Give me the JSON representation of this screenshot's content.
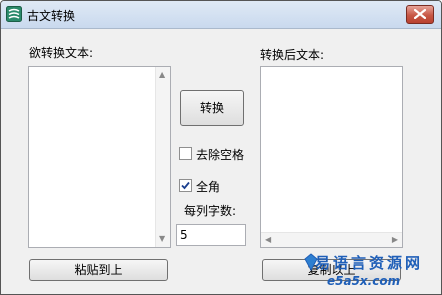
{
  "window": {
    "title": "古文转换",
    "close_icon": "close-icon"
  },
  "left": {
    "label": "欲转换文本:",
    "text": "",
    "paste_button": "粘贴到上"
  },
  "right": {
    "label": "转换后文本:",
    "text": "",
    "copy_button": "复制以上"
  },
  "middle": {
    "convert_button": "转换",
    "remove_spaces": {
      "label": "去除空格",
      "checked": false
    },
    "full_width": {
      "label": "全角",
      "checked": true
    },
    "chars_per_column_label": "每列字数:",
    "chars_per_column_value": "5"
  },
  "watermark": {
    "title": "易语言资源网",
    "url": "e5a5x.com"
  },
  "colors": {
    "title_gradient_top": "#dfe9f5",
    "close_red": "#c75745",
    "watermark_blue": "#1f5fb8"
  }
}
